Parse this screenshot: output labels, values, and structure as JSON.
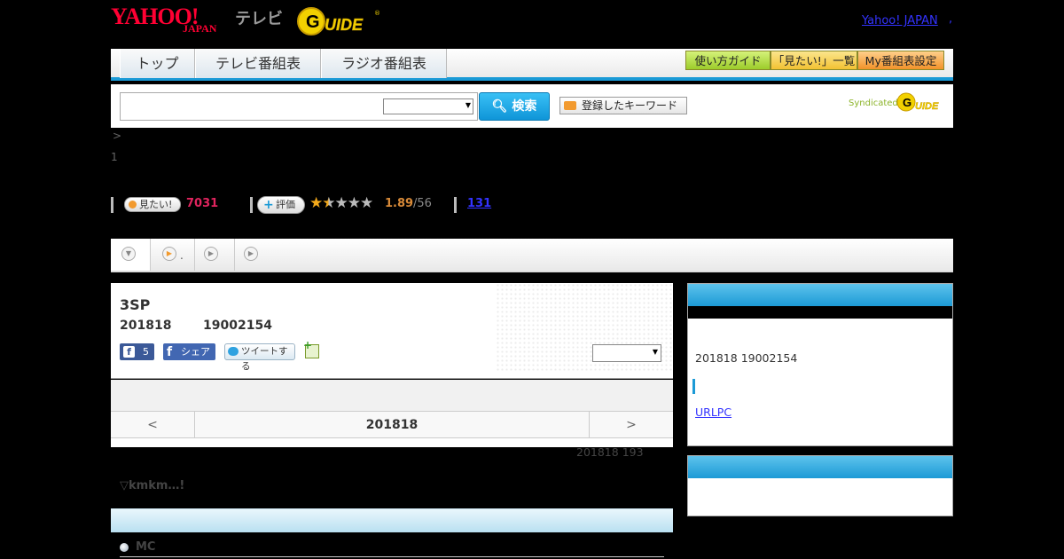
{
  "header": {
    "yahoo_logo": "YAHOO!",
    "yahoo_sub": "JAPAN",
    "tv_label": "テレビ",
    "gguide_logo": "G-GUIDE",
    "yj_link": "Yahoo! JAPAN",
    "yj_dot": ","
  },
  "nav": {
    "tabs": [
      {
        "label": "トップ"
      },
      {
        "label": "テレビ番組表"
      },
      {
        "label": "ラジオ番組表"
      }
    ],
    "right_buttons": [
      {
        "label": "使い方ガイド"
      },
      {
        "label": "「見たい!」一覧"
      },
      {
        "label": "My番組表設定"
      }
    ]
  },
  "search": {
    "input_value": "",
    "select_value": "",
    "button_label": "検索",
    "keyword_button": "登録したキーワード",
    "syndicated": "Syndicated"
  },
  "breadcrumb": {
    "arrow": ">",
    "number": "1"
  },
  "rating": {
    "mitai_label": "見たい!",
    "mitai_count": "7031",
    "hyoka_label": "評価",
    "score": "1.89",
    "score_count": "/56",
    "stars_filled": 1.5,
    "review_count": "131"
  },
  "subtabs": [
    {
      "icon": "down-circle-icon",
      "label": ""
    },
    {
      "icon": "play-circle-icon",
      "label": "."
    },
    {
      "icon": "play-circle-icon",
      "label": ""
    },
    {
      "icon": "play-circle-icon",
      "label": ""
    }
  ],
  "program": {
    "title": "3SP",
    "date": "201818",
    "time": "19002154",
    "fb_like_count": "5",
    "fb_share_label": "シェア",
    "tweet_label": "ツイートする",
    "select_value": ""
  },
  "pager": {
    "prev": "<",
    "date": "201818",
    "next": ">"
  },
  "broadcast_note": "201818  193",
  "episode_text": "▽kmkm…!",
  "cast": {
    "mc_label": "MC"
  },
  "sidebar": {
    "date_text": "201818  19002154",
    "url_link": "URLPC"
  },
  "colors": {
    "accent_blue": "#1c9ad6",
    "yahoo_red": "#ff0033",
    "mitai_pink": "#e0245e",
    "score_orange": "#d88a38"
  }
}
